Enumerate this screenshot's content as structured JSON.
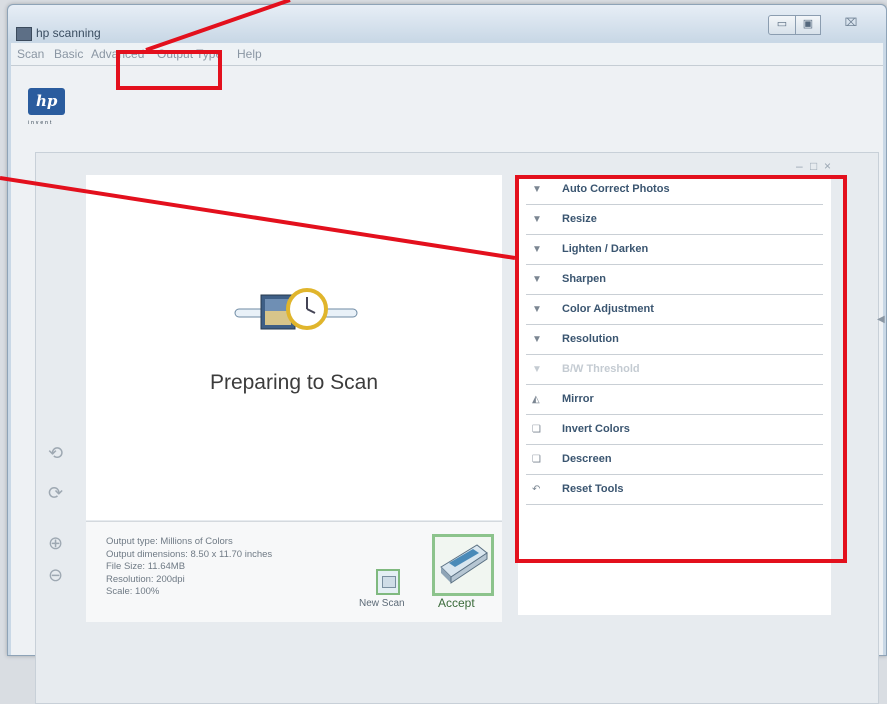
{
  "window": {
    "title": "hp scanning",
    "controls": {
      "minimize": "▭",
      "maximize": "▣",
      "close": "⌧"
    }
  },
  "menu": [
    "Scan",
    "Basic",
    "Advanced",
    "Output Type",
    "Help"
  ],
  "logo": {
    "text": "hp",
    "subtext": "invent"
  },
  "panel": {
    "min_glyph": "–",
    "max_glyph": "□",
    "close_glyph": "×"
  },
  "preview": {
    "status": "Preparing to Scan"
  },
  "info": {
    "output_type": "Output type: Millions of Colors",
    "output_dimensions": "Output dimensions: 8.50 x 11.70 inches",
    "file_size": "File Size: 11.64MB",
    "resolution": "Resolution: 200dpi",
    "scale": "Scale: 100%",
    "new_scan": "New Scan",
    "accept": "Accept"
  },
  "tools": [
    {
      "label": "Auto Correct Photos",
      "icon": "chevron-down-icon",
      "glyph": "▼",
      "disabled": false
    },
    {
      "label": "Resize",
      "icon": "chevron-down-icon",
      "glyph": "▼",
      "disabled": false
    },
    {
      "label": "Lighten / Darken",
      "icon": "chevron-down-icon",
      "glyph": "▼",
      "disabled": false
    },
    {
      "label": "Sharpen",
      "icon": "chevron-down-icon",
      "glyph": "▼",
      "disabled": false
    },
    {
      "label": "Color Adjustment",
      "icon": "chevron-down-icon",
      "glyph": "▼",
      "disabled": false
    },
    {
      "label": "Resolution",
      "icon": "chevron-down-icon",
      "glyph": "▼",
      "disabled": false
    },
    {
      "label": "B/W Threshold",
      "icon": "chevron-down-icon",
      "glyph": "▼",
      "disabled": true
    },
    {
      "label": "Mirror",
      "icon": "mirror-icon",
      "glyph": "◭",
      "disabled": false
    },
    {
      "label": "Invert Colors",
      "icon": "invert-icon",
      "glyph": "❏",
      "disabled": false
    },
    {
      "label": "Descreen",
      "icon": "descreen-icon",
      "glyph": "❏",
      "disabled": false
    },
    {
      "label": "Reset Tools",
      "icon": "reset-icon",
      "glyph": "↶",
      "disabled": false
    }
  ],
  "side_tools": [
    {
      "icon": "rotate-left-icon",
      "glyph": "⟲"
    },
    {
      "icon": "rotate-right-icon",
      "glyph": "⟳"
    },
    {
      "icon": "zoom-in-icon",
      "glyph": "⊕"
    },
    {
      "icon": "zoom-out-icon",
      "glyph": "⊖"
    }
  ],
  "annotation_color": "#e3101d"
}
